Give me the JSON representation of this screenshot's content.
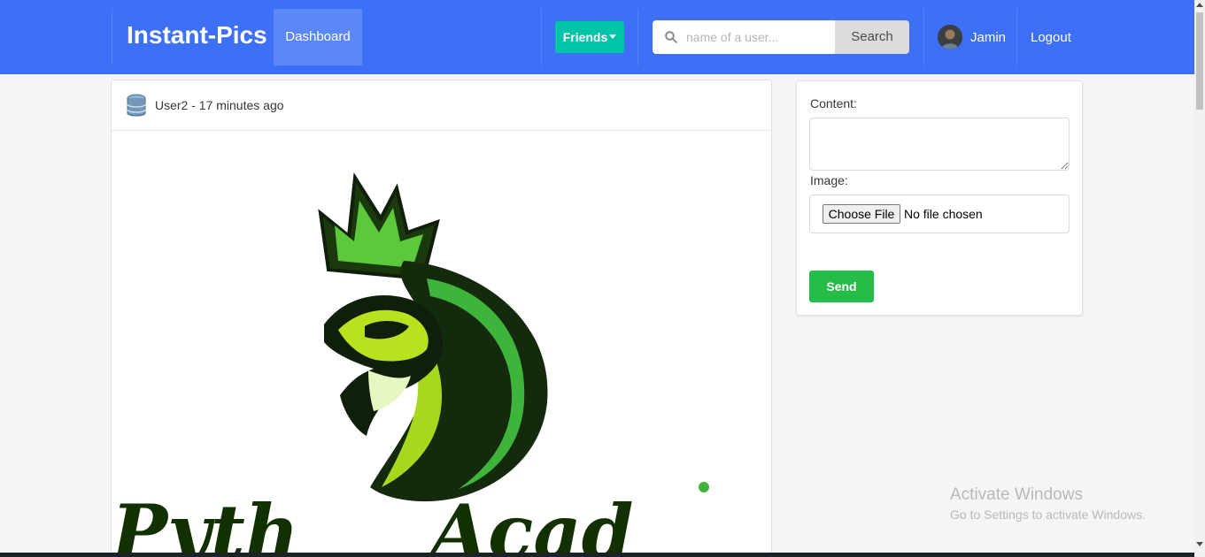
{
  "navbar": {
    "brand": "Instant-Pics",
    "dashboard_label": "Dashboard",
    "friends_label": "Friends",
    "search_placeholder": "name of a user...",
    "search_button": "Search",
    "user_name": "Jamin",
    "logout_label": "Logout",
    "colors": {
      "bar": "#3e6ff7",
      "friends": "#00c4a7"
    }
  },
  "post": {
    "meta": "User2 - 17 minutes ago",
    "image_icon": "python-snake-logo"
  },
  "form": {
    "content_label": "Content:",
    "content_value": "",
    "image_label": "Image:",
    "choose_file_label": "Choose File",
    "file_status": "No file chosen",
    "send_label": "Send",
    "send_color": "#23bd47"
  },
  "watermark": {
    "title": "Activate Windows",
    "subtitle": "Go to Settings to activate Windows."
  }
}
